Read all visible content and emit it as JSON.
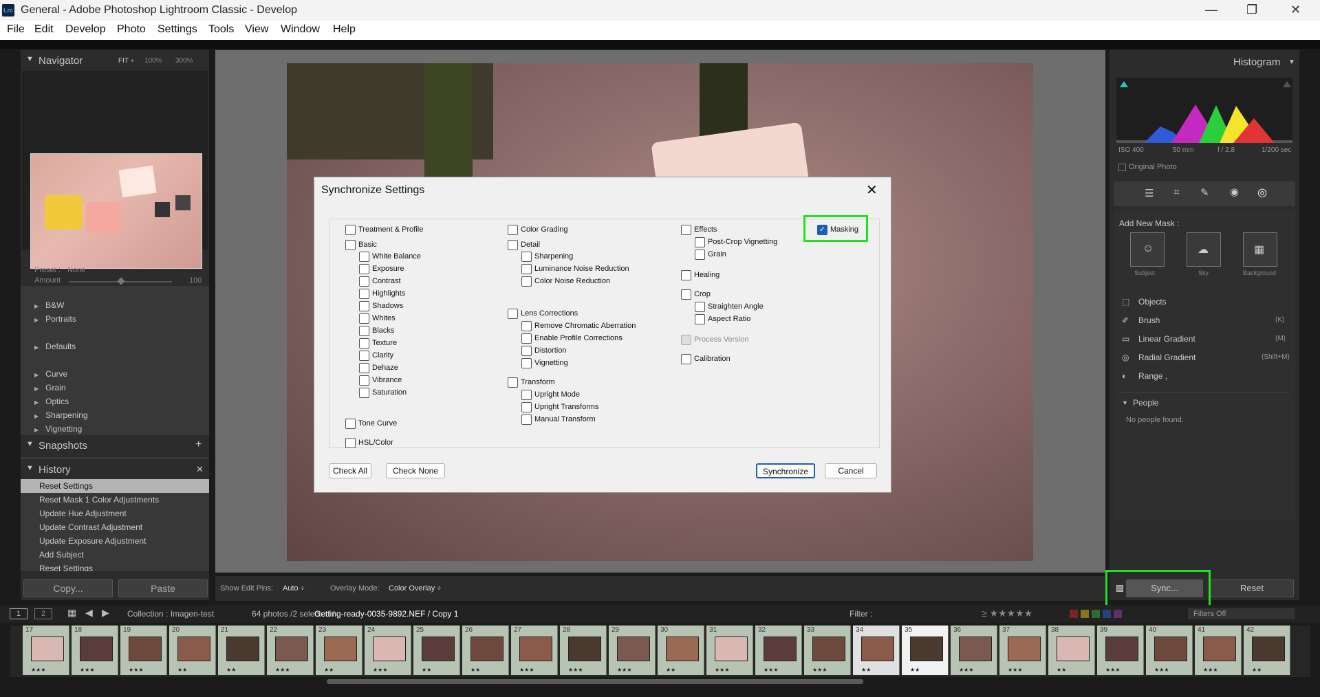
{
  "window": {
    "title": "General - Adobe Photoshop Lightroom Classic - Develop",
    "app_badge": "Lrc",
    "minimize": "—",
    "maximize": "❐",
    "close": "✕"
  },
  "menu": [
    "File",
    "Edit",
    "Develop",
    "Photo",
    "Settings",
    "Tools",
    "View",
    "Window",
    "Help"
  ],
  "navigator": {
    "title": "Navigator",
    "fit": "FIT ÷",
    "z100": "100%",
    "z300": "300%"
  },
  "presets": {
    "preset_label": "Preset :",
    "preset_value": "None",
    "amount_label": "Amount",
    "amount_value": "100",
    "items": [
      "B&W",
      "Portraits",
      "Defaults",
      "Curve",
      "Grain",
      "Optics",
      "Sharpening",
      "Vignetting"
    ]
  },
  "snapshots": {
    "title": "Snapshots",
    "add": "+"
  },
  "history": {
    "title": "History",
    "close": "✕",
    "items": [
      "Reset Settings",
      "Reset Mask 1 Color Adjustments",
      "Update Hue Adjustment",
      "Update Contrast Adjustment",
      "Update Exposure Adjustment",
      "Add Subject",
      "Reset Settings"
    ]
  },
  "left_buttons": {
    "copy": "Copy...",
    "paste": "Paste"
  },
  "toolbar": {
    "pins_label": "Show Edit Pins:",
    "pins_value": "Auto ÷",
    "overlay_label": "Overlay Mode:",
    "overlay_value": "Color Overlay ÷"
  },
  "histogram": {
    "title": "Histogram",
    "iso": "ISO 400",
    "focal": "50 mm",
    "aperture": "f / 2.8",
    "shutter": "1/200 sec",
    "original": "Original Photo"
  },
  "masking": {
    "add_new": "Add New Mask :",
    "subject": "Subject",
    "sky": "Sky",
    "background": "Background",
    "objects": "Objects",
    "brush": "Brush",
    "brush_key": "(K)",
    "linear": "Linear Gradient",
    "linear_key": "(M)",
    "radial": "Radial Gradient",
    "radial_key": "(Shift+M)",
    "range": "Range ,"
  },
  "people": {
    "title": "People",
    "empty": "No people found."
  },
  "right_buttons": {
    "sync": "Sync...",
    "reset": "Reset"
  },
  "filmstrip_header": {
    "view1": "1",
    "view2": "2",
    "collection": "Collection : Imagen-test",
    "count": "64 photos /2 selected /",
    "file": "Getting-ready-0035-9892.NEF / Copy 1",
    "filter": "Filter :",
    "filters_off": "Filters Off",
    "stars": "≥ ★★★★★"
  },
  "film": [
    {
      "n": "17",
      "s": "★★★"
    },
    {
      "n": "18",
      "s": "★★★"
    },
    {
      "n": "19",
      "s": "★★★"
    },
    {
      "n": "20",
      "s": "★★"
    },
    {
      "n": "21",
      "s": "★★"
    },
    {
      "n": "22",
      "s": "★★★"
    },
    {
      "n": "23",
      "s": "★★"
    },
    {
      "n": "24",
      "s": "★★★"
    },
    {
      "n": "25",
      "s": "★★"
    },
    {
      "n": "26",
      "s": "★★"
    },
    {
      "n": "27",
      "s": "★★★"
    },
    {
      "n": "28",
      "s": "★★★"
    },
    {
      "n": "29",
      "s": "★★★"
    },
    {
      "n": "30",
      "s": "★★"
    },
    {
      "n": "31",
      "s": "★★★"
    },
    {
      "n": "32",
      "s": "★★★"
    },
    {
      "n": "33",
      "s": "★★★"
    },
    {
      "n": "34",
      "s": "★★"
    },
    {
      "n": "35",
      "s": "★★"
    },
    {
      "n": "36",
      "s": "★★★"
    },
    {
      "n": "37",
      "s": "★★★"
    },
    {
      "n": "38",
      "s": "★★"
    },
    {
      "n": "39",
      "s": "★★★"
    },
    {
      "n": "40",
      "s": "★★★"
    },
    {
      "n": "41",
      "s": "★★★"
    },
    {
      "n": "42",
      "s": "★★"
    }
  ],
  "dialog": {
    "title": "Synchronize Settings",
    "close": "✕",
    "check_all": "Check All",
    "check_none": "Check None",
    "synchronize": "Synchronize",
    "cancel": "Cancel",
    "col1": [
      "Treatment & Profile",
      "Basic",
      "White Balance",
      "Exposure",
      "Contrast",
      "Highlights",
      "Shadows",
      "Whites",
      "Blacks",
      "Texture",
      "Clarity",
      "Dehaze",
      "Vibrance",
      "Saturation",
      "Tone Curve",
      "HSL/Color"
    ],
    "col2": [
      "Color Grading",
      "Detail",
      "Sharpening",
      "Luminance Noise Reduction",
      "Color Noise Reduction",
      "Lens Corrections",
      "Remove Chromatic Aberration",
      "Enable Profile Corrections",
      "Distortion",
      "Vignetting",
      "Transform",
      "Upright Mode",
      "Upright Transforms",
      "Manual Transform"
    ],
    "col3": [
      "Effects",
      "Post-Crop Vignetting",
      "Grain",
      "Healing",
      "Crop",
      "Straighten Angle",
      "Aspect Ratio",
      "Process Version",
      "Calibration"
    ],
    "masking": "Masking",
    "check": "✓"
  }
}
